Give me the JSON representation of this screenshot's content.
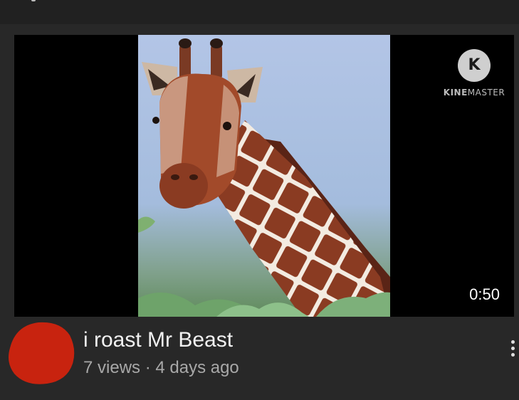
{
  "video": {
    "duration": "0:50",
    "watermark": {
      "logo_letter": "K",
      "brand_bold": "KINE",
      "brand_light": "MASTER"
    },
    "thumbnail_subject": "giraffe-head"
  },
  "details": {
    "title": "i roast Mr Beast",
    "meta": "7 views · 4 days ago"
  },
  "colors": {
    "background": "#282828",
    "topbar": "#212121",
    "avatar": "#c8230f",
    "sky": "#a9bde0",
    "giraffe_patch": "#8a3b22"
  },
  "icons": {
    "more": "more-vert-icon",
    "watermark": "kinemaster-logo-icon"
  }
}
